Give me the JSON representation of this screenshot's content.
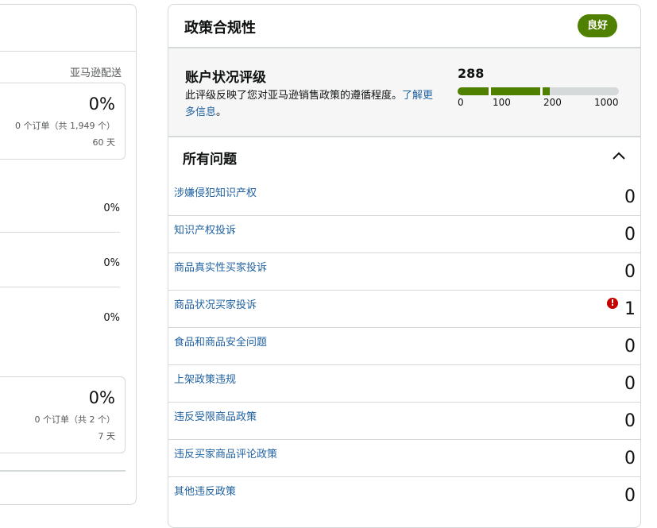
{
  "left": {
    "column_label": "亚马逊配送",
    "card1": {
      "percent": "0%",
      "orders": "0 个订单（共 1,949 个）",
      "days": "60 天"
    },
    "rows": [
      "0%",
      "0%",
      "0%"
    ],
    "card2": {
      "percent": "0%",
      "orders": "0 个订单（共 2 个）",
      "days": "7 天"
    }
  },
  "policy": {
    "title": "政策合规性",
    "badge": "良好",
    "badge_color": "#508000",
    "rating": {
      "title": "账户状况评级",
      "description": "此评级反映了您对亚马逊销售政策的遵循程度。",
      "learn_more": "了解更多信息",
      "period": "。",
      "score": "288",
      "scale": {
        "min": 0,
        "max": 1000,
        "value": 288,
        "markers": [
          100,
          200
        ]
      },
      "labels": [
        "0",
        "100",
        "200",
        "1000"
      ]
    },
    "issues_title": "所有问题",
    "collapse_icon": "chevron-up-icon",
    "issues": [
      {
        "label": "涉嫌侵犯知识产权",
        "count": "0",
        "warning": false
      },
      {
        "label": "知识产权投诉",
        "count": "0",
        "warning": false
      },
      {
        "label": "商品真实性买家投诉",
        "count": "0",
        "warning": false
      },
      {
        "label": "商品状况买家投诉",
        "count": "1",
        "warning": true
      },
      {
        "label": "食品和商品安全问题",
        "count": "0",
        "warning": false
      },
      {
        "label": "上架政策违规",
        "count": "0",
        "warning": false
      },
      {
        "label": "违反受限商品政策",
        "count": "0",
        "warning": false
      },
      {
        "label": "违反买家商品评论政策",
        "count": "0",
        "warning": false
      },
      {
        "label": "其他违反政策",
        "count": "0",
        "warning": false
      }
    ],
    "warning_icon": "exclamation-icon",
    "warning_symbol": "!"
  }
}
